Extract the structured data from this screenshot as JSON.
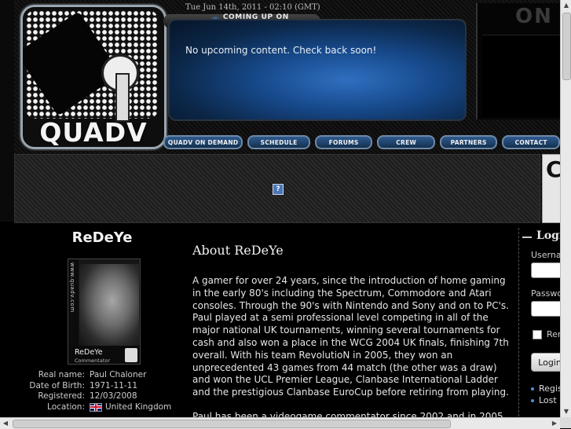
{
  "header": {
    "logo_text": "QUADV",
    "datetime": "Tue Jun 14th, 2011 - 02:10 (GMT)",
    "coming_label": "COMING UP ON QUADV",
    "upcoming_message": "No upcoming content. Check back soon!",
    "onair_text": "ON"
  },
  "nav": {
    "items": [
      {
        "label": "QUADV ON DEMAND"
      },
      {
        "label": "SCHEDULE"
      },
      {
        "label": "FORUMS"
      },
      {
        "label": "CREW"
      },
      {
        "label": "PARTNERS"
      },
      {
        "label": "CONTACT"
      }
    ]
  },
  "ad": {
    "icon_glyph": "?",
    "right_glyph": "C"
  },
  "profile": {
    "name": "ReDeYe",
    "photo_side_text": "www.quadv.com",
    "photo_name": "ReDeYe",
    "photo_role": "Commentator",
    "details": [
      {
        "label": "Real name:",
        "value": "Paul Chaloner"
      },
      {
        "label": "Date of Birth:",
        "value": "1971-11-11"
      },
      {
        "label": "Registered:",
        "value": "12/03/2008"
      },
      {
        "label": "Location:",
        "value": "United Kingdom"
      }
    ]
  },
  "about": {
    "title": "About ReDeYe",
    "paragraphs": [
      "A gamer for over 24 years, since the introduction of home gaming in the early 80's including the Spectrum, Commodore and Atari consoles. Through the 90's with Nintendo and Sony and on to PC's. Paul played at a semi professional level competing in all of the major national UK tournaments, winning several tournaments for cash and also won a place in the WCG 2004 UK finals, finishing 7th overall. With his team RevolutioN in 2005, they won an unprecedented 43 games from 44 match (the other was a draw) and won the UCL Premier League, Clanbase International Ladder and the prestigious Clanbase EuroCup before retiring from playing.",
      "Paul has been a videogame commentator since 2002 and in 2005"
    ]
  },
  "login": {
    "title": "Login",
    "username_label": "Username",
    "password_label": "Password",
    "remember_label": "Remember me",
    "button_label": "Login",
    "register_link": "Register",
    "lost_link": "Lost password"
  },
  "scrollbars": {
    "up": "▲",
    "down": "▼",
    "left": "◀",
    "right": "▶"
  }
}
